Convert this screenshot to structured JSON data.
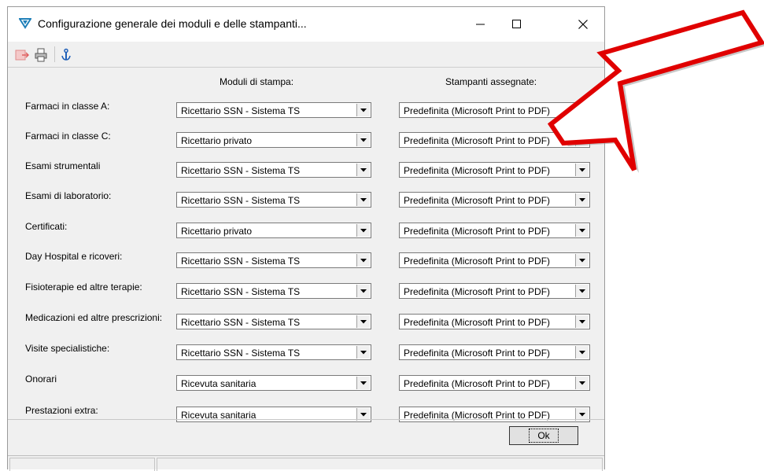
{
  "window": {
    "title": "Configurazione generale dei moduli e delle stampanti..."
  },
  "toolbar": {
    "icons": [
      "export-icon",
      "printer-icon",
      "anchor-icon"
    ]
  },
  "columns": {
    "modules": "Moduli di stampa:",
    "printers": "Stampanti assegnate:"
  },
  "rows": [
    {
      "label": "Farmaci in classe A:",
      "module": "Ricettario SSN - Sistema TS",
      "printer": "Predefinita (Microsoft Print to PDF)"
    },
    {
      "label": "Farmaci in classe C:",
      "module": "Ricettario privato",
      "printer": "Predefinita (Microsoft Print to PDF)"
    },
    {
      "label": "Esami strumentali",
      "module": "Ricettario SSN - Sistema TS",
      "printer": "Predefinita (Microsoft Print to PDF)"
    },
    {
      "label": "Esami di laboratorio:",
      "module": "Ricettario SSN - Sistema TS",
      "printer": "Predefinita (Microsoft Print to PDF)"
    },
    {
      "label": "Certificati:",
      "module": "Ricettario privato",
      "printer": "Predefinita (Microsoft Print to PDF)"
    },
    {
      "label": "Day Hospital e ricoveri:",
      "module": "Ricettario SSN - Sistema TS",
      "printer": "Predefinita (Microsoft Print to PDF)"
    },
    {
      "label": "Fisioterapie ed altre terapie:",
      "module": "Ricettario SSN - Sistema TS",
      "printer": "Predefinita (Microsoft Print to PDF)"
    },
    {
      "label": "Medicazioni ed altre prescrizioni:",
      "module": "Ricettario SSN - Sistema TS",
      "printer": "Predefinita (Microsoft Print to PDF)"
    },
    {
      "label": "Visite specialistiche:",
      "module": "Ricettario SSN - Sistema TS",
      "printer": "Predefinita (Microsoft Print to PDF)"
    },
    {
      "label": "Onorari",
      "module": "Ricevuta sanitaria",
      "printer": "Predefinita (Microsoft Print to PDF)"
    },
    {
      "label": "Prestazioni extra:",
      "module": "Ricevuta sanitaria",
      "printer": "Predefinita (Microsoft Print to PDF)"
    }
  ],
  "footer": {
    "ok_label": "Ok"
  },
  "colors": {
    "annotation_arrow": "#e00000",
    "app_icon": "#1e7fb8"
  }
}
